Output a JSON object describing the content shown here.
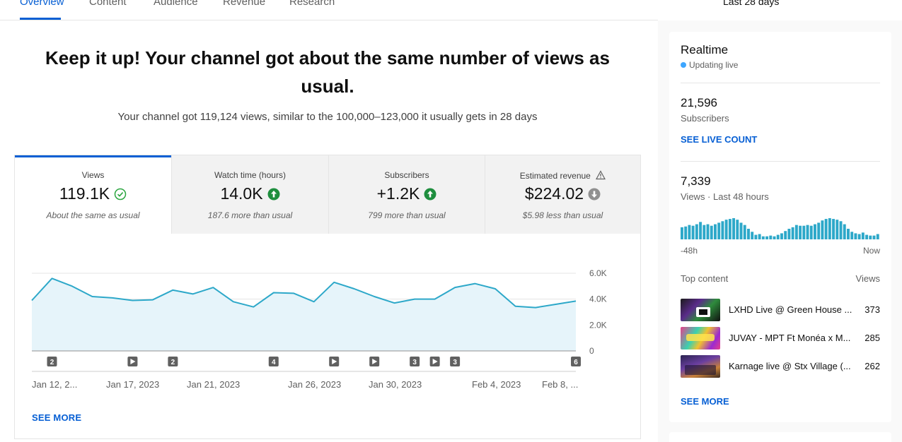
{
  "tabs": [
    {
      "label": "Overview",
      "active": true
    },
    {
      "label": "Content"
    },
    {
      "label": "Audience"
    },
    {
      "label": "Revenue"
    },
    {
      "label": "Research"
    }
  ],
  "date_range": "Last 28 days",
  "headline": "Keep it up! Your channel got about the same number of views as usual.",
  "summary": "Your channel got 119,124 views, similar to the 100,000–123,000 it usually gets in 28 days",
  "metrics": [
    {
      "label": "Views",
      "value": "119.1K",
      "note": "About the same as usual",
      "icon": "check-circle-icon",
      "selected": true
    },
    {
      "label": "Watch time (hours)",
      "value": "14.0K",
      "note": "187.6 more than usual",
      "icon": "arrow-up-circle-icon"
    },
    {
      "label": "Subscribers",
      "value": "+1.2K",
      "note": "799 more than usual",
      "icon": "arrow-up-circle-icon"
    },
    {
      "label": "Estimated revenue",
      "value": "$224.02",
      "note": "$5.98 less than usual",
      "icon": "arrow-down-circle-icon",
      "warning_icon": "warning-icon"
    }
  ],
  "chart_data": {
    "type": "area",
    "series": [
      {
        "values": [
          3900,
          5600,
          5000,
          4200,
          4100,
          3900,
          3950,
          4700,
          4400,
          4900,
          3800,
          3400,
          4500,
          4450,
          3800,
          5300,
          4800,
          4200,
          3700,
          4000,
          4000,
          4900,
          5200,
          4800,
          3450,
          3350,
          3600,
          3850
        ]
      }
    ],
    "ylim": [
      0,
      6000
    ],
    "yticks": [
      "6.0K",
      "4.0K",
      "2.0K",
      "0"
    ],
    "xticks": [
      "Jan 12, 2...",
      "Jan 17, 2023",
      "Jan 21, 2023",
      "Jan 26, 2023",
      "Jan 30, 2023",
      "Feb 4, 2023",
      "Feb 8, ..."
    ],
    "markers": [
      {
        "day": 1,
        "kind": "count",
        "label": "2"
      },
      {
        "day": 5,
        "kind": "play"
      },
      {
        "day": 7,
        "kind": "count",
        "label": "2"
      },
      {
        "day": 12,
        "kind": "count",
        "label": "4"
      },
      {
        "day": 15,
        "kind": "play"
      },
      {
        "day": 17,
        "kind": "play"
      },
      {
        "day": 19,
        "kind": "count",
        "label": "3"
      },
      {
        "day": 20,
        "kind": "play"
      },
      {
        "day": 21,
        "kind": "count",
        "label": "3"
      },
      {
        "day": 27,
        "kind": "count",
        "label": "6"
      }
    ],
    "colors": {
      "line": "#2da8c9",
      "fill": "#e6f4fa",
      "grid": "#e5e5e5"
    }
  },
  "chart_see_more": "SEE MORE",
  "realtime": {
    "title": "Realtime",
    "status": "Updating live",
    "subscribers_value": "21,596",
    "subscribers_label": "Subscribers",
    "live_count_link": "SEE LIVE COUNT",
    "views_value": "7,339",
    "views_label": "Views · Last 48 hours",
    "hourly_views": [
      16,
      17,
      19,
      18,
      20,
      23,
      19,
      20,
      18,
      20,
      22,
      24,
      26,
      27,
      28,
      26,
      22,
      19,
      14,
      10,
      6,
      7,
      4,
      4,
      5,
      4,
      6,
      8,
      11,
      14,
      16,
      19,
      18,
      18,
      19,
      18,
      20,
      22,
      25,
      27,
      28,
      27,
      26,
      24,
      20,
      14,
      10,
      8,
      7,
      9,
      6,
      5,
      5,
      7
    ],
    "axis_start": "-48h",
    "axis_end": "Now",
    "top_content_label": "Top content",
    "views_column_label": "Views",
    "top_content": [
      {
        "title": "LXHD Live @ Green House ...",
        "views": "373"
      },
      {
        "title": "JUVAY - MPT Ft Monéa x M...",
        "views": "285"
      },
      {
        "title": "Karnage live @ Stx Village (...",
        "views": "262"
      }
    ],
    "see_more": "SEE MORE",
    "colors": {
      "bars": "#2da8c9",
      "live_dot": "#3ea6ff"
    }
  }
}
